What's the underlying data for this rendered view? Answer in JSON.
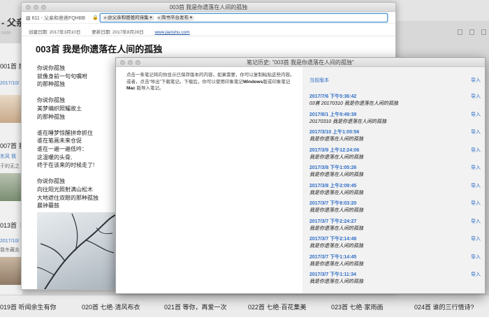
{
  "background_app": {
    "title": "- 父亲",
    "subtitle": "note",
    "notes": [
      {
        "title": "001首 燃",
        "date": ""
      },
      {
        "title": "",
        "date": "2017/10/"
      },
      {
        "title": "007首 我",
        "date": "东风  我"
      },
      {
        "title": "",
        "date": "于的无之"
      },
      {
        "title": "",
        "date": "2017/10/"
      },
      {
        "title": "013首 卜",
        "date": ""
      },
      {
        "title": "",
        "date": "2017/10/"
      },
      {
        "title": "",
        "date": "我冬藏去"
      }
    ],
    "bottom_notes": [
      "019首 听闻余生有你",
      "020首 七绝·清风布衣",
      "021首 等你，再爱一次",
      "022首 七绝·百花集美",
      "023首 七绝·家雨画",
      "024首 谁的三行情诗?"
    ]
  },
  "note_window": {
    "window_title": "003首 我是你遗落在人间的孤独",
    "notebook": "611 - 父亲和爸爸FQHBB",
    "lock_icon": "lock-icon",
    "tags": [
      "@父亲和爸爸的诗集",
      "简书平台发布"
    ],
    "created": "创建日期: 2017年3月10日",
    "updated": "更新日期: 2017年8月28日",
    "source_url": "www.jianshu.com",
    "title": "003首 我是你遗落在人间的孤独",
    "poem_lines": [
      "你说你孤独",
      "就像身前一句句嘱咐",
      "的那种孤独",
      "",
      "你说你孤独",
      "美梦编织照耀故土",
      "的那种孤独",
      "",
      "谁在睡梦惊醒拼命抓住",
      "谁在笔画未来仓促",
      "谁在一遍一遍低吟：",
      "这温暖的头骨,",
      "终于在该来的时候走了!",
      "",
      "你说你孤独",
      "向往阳光照射满山松木",
      "大地遮住双眼的那种孤独",
      "晨钟暮鼓"
    ]
  },
  "history_window": {
    "window_title": "笔记历史: \"003首 我是你遗落在人间的孤独\"",
    "description_parts": [
      "点击一条笔记将向你显示已保存版本的内容。如果需要，你可以复制粘贴这些内容。或者，点击“导出”下载笔记。下载后，你可以使用印象笔记",
      "Windows",
      "版或印象笔记 ",
      "Mac",
      " 版导入笔记。"
    ],
    "current_label": "当前版本",
    "import_label": "导入",
    "revisions": [
      {
        "date": "2017/7/6 下午5:36:42",
        "name": "03首 20170310 我是你遗落在人间的孤独"
      },
      {
        "date": "2017/6/1 上午9:49:39",
        "name": "20170310 我是你遗落在人间的孤独"
      },
      {
        "date": "2017/3/10 上午1:00:56",
        "name": "我是你遗落在人间的孤独"
      },
      {
        "date": "2017/3/9 上午12:24:06",
        "name": "我是你遗落在人间的孤独"
      },
      {
        "date": "2017/3/8 下午1:05:26",
        "name": "我是你遗落在人间的孤独"
      },
      {
        "date": "2017/3/8 上午2:09:45",
        "name": "我是你遗落在人间的孤独"
      },
      {
        "date": "2017/3/7 下午8:03:20",
        "name": "我是你遗落在人间的孤独"
      },
      {
        "date": "2017/3/7 下午2:24:27",
        "name": "我是你遗落在人间的孤独"
      },
      {
        "date": "2017/3/7 下午2:14:48",
        "name": "我是你遗落在人间的孤独"
      },
      {
        "date": "2017/3/7 下午1:14:45",
        "name": "我是你遗落在人间的孤独"
      },
      {
        "date": "2017/3/7 下午1:11:34",
        "name": "我是你遗落在人间的孤独"
      }
    ]
  },
  "colors": {
    "link_blue": "#2f6ec7",
    "focus_blue": "#5b9bd5"
  }
}
